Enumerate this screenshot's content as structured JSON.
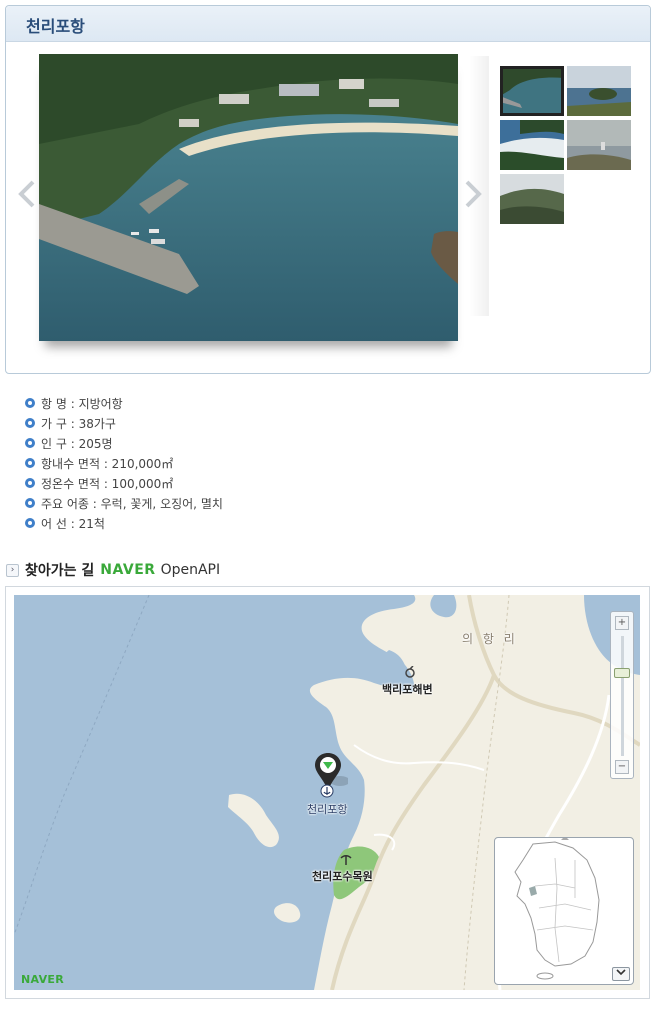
{
  "gallery": {
    "title": "천리포항",
    "prev_icon": "chevron-left-icon",
    "next_icon": "chevron-right-icon",
    "thumbnail_count": 5,
    "selected_thumbnail": 1
  },
  "info": {
    "items": [
      "항 명 : 지방어항",
      "가 구 : 38가구",
      "인 구 : 205명",
      "항내수 면적 : 210,000㎡",
      "정온수 면적 : 100,000㎡",
      "주요 어종 : 우럭, 꽃게, 오징어, 멸치",
      "어 선 : 21척"
    ]
  },
  "directions": {
    "title": "찾아가는 길",
    "provider_logo": "NAVER",
    "provider_suffix": "OpenAPI"
  },
  "map": {
    "labels": {
      "town": "의 항 리",
      "beach": "백리포해변",
      "port": "천리포항",
      "arboretum": "천리포수목원"
    },
    "zoom_in": "+",
    "zoom_out": "−",
    "watermark": "NAVER",
    "minimap_toggle_icon": "chevron-down-icon",
    "colors": {
      "sea": "#a5c0d8",
      "land": "#f2efe4",
      "park": "#8ec77a",
      "marker": "#2b2b2b",
      "marker_arrow": "#3fb84a"
    }
  }
}
